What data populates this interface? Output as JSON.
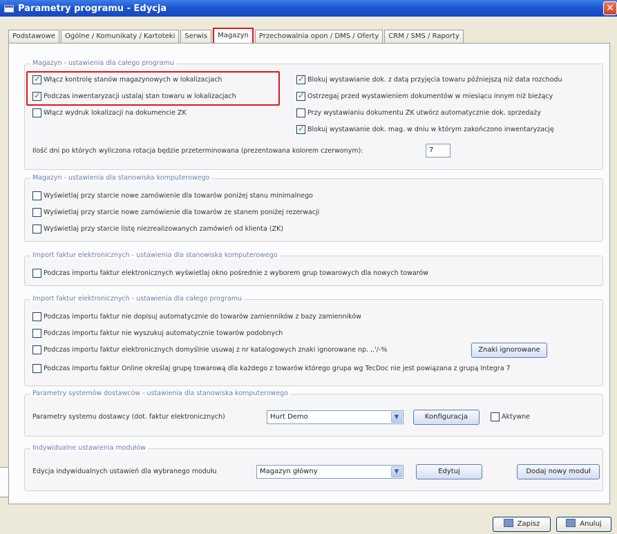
{
  "window": {
    "title": "Parametry programu - Edycja",
    "close_glyph": "✕"
  },
  "tabs": [
    {
      "label": "Podstawowe"
    },
    {
      "label": "Ogólne / Komunikaty / Kartoteki"
    },
    {
      "label": "Serwis"
    },
    {
      "label": "Magazyn",
      "active": true
    },
    {
      "label": "Przechowalnia opon / DMS / Oferty"
    },
    {
      "label": "CRM / SMS / Raporty"
    }
  ],
  "group_magazyn_program": {
    "title": "Magazyn - ustawienia dla całego programu",
    "left_options": [
      {
        "label": "Włącz kontrolę stanów magazynowych w lokalizacjach",
        "checked": true
      },
      {
        "label": "Podczas inwentaryzacji ustalaj stan towaru w lokalizacjach",
        "checked": true
      },
      {
        "label": "Włącz wydruk lokalizacji na dokumencie ZK",
        "checked": false
      }
    ],
    "right_options": [
      {
        "label": "Blokuj wystawianie dok. z datą przyjęcia towaru późniejszą niż data rozchodu",
        "checked": true
      },
      {
        "label": "Ostrzegaj przed wystawieniem dokumentów w miesiącu innym niż bieżący",
        "checked": true
      },
      {
        "label": "Przy wystawianiu dokumentu ZK utwórz automatycznie dok. sprzedaży",
        "checked": false
      },
      {
        "label": "Blokuj wystawianie dok. mag. w dniu w którym zakończono inwentaryzację",
        "checked": true
      }
    ],
    "rotation_label": "Ilość dni po których wyliczona rotacja będzie przeterminowana (prezentowana kolorem czerwonym):",
    "rotation_value": "7"
  },
  "group_magazyn_station": {
    "title": "Magazyn - ustawienia dla stanowiska komputerowego",
    "options": [
      {
        "label": "Wyświetlaj przy starcie nowe zamówienie dla towarów poniżej stanu minimalnego",
        "checked": false
      },
      {
        "label": "Wyświetlaj przy starcie nowe zamówienie dla towarów ze stanem poniżej rezerwacji",
        "checked": false
      },
      {
        "label": "Wyświetlaj przy starcie listę niezrealizowanych zamówień od klienta (ZK)",
        "checked": false
      }
    ]
  },
  "group_import_station": {
    "title": "Import faktur elektronicznych - ustawienia dla stanowiska komputerowego",
    "options": [
      {
        "label": "Podczas importu faktur elektronicznych wyświetlaj okno pośrednie z wyborem grup towarowych dla nowych towarów",
        "checked": false
      }
    ]
  },
  "group_import_program": {
    "title": "Import faktur elektronicznych - ustawienia dla całego programu",
    "options": [
      {
        "label": "Podczas importu faktur nie dopisuj automatycznie do towarów zamienników z bazy zamienników",
        "checked": false
      },
      {
        "label": "Podczas importu faktur nie wyszukuj automatycznie towarów podobnych",
        "checked": false
      },
      {
        "label": "Podczas importu faktur elektronicznych domyślnie usuwaj z nr katalogowych znaki ignorowane np. ,.'/-%",
        "checked": false
      },
      {
        "label": "Podczas importu faktur Online określaj grupę towarową dla każdego z towarów którego grupa wg TecDoc nie jest powiązana z grupą Integra 7",
        "checked": false
      }
    ],
    "ignored_chars_button": "Znaki ignorowane"
  },
  "group_suppliers": {
    "title": "Parametry systemów dostawców - ustawienia dla stanowiska komputerowego",
    "label": "Parametry systemu dostawcy (dot. faktur elektronicznych)",
    "selected_supplier": "Hurt Demo",
    "config_button": "Konfiguracja",
    "active_label": "Aktywne",
    "active_checked": false
  },
  "group_modules": {
    "title": "Indywidualne ustawienia modułów",
    "label": "Edycja indywidualnych ustawień dla wybranego modułu",
    "selected_module": "Magazyn główny",
    "edit_button": "Edytuj",
    "add_button": "Dodaj nowy moduł"
  },
  "footer": {
    "save_button": "Zapisz",
    "cancel_button": "Anuluj"
  },
  "colors": {
    "title_bar": "#1d55d0",
    "highlight": "#e0161b",
    "group_title": "#6b7fb0"
  }
}
